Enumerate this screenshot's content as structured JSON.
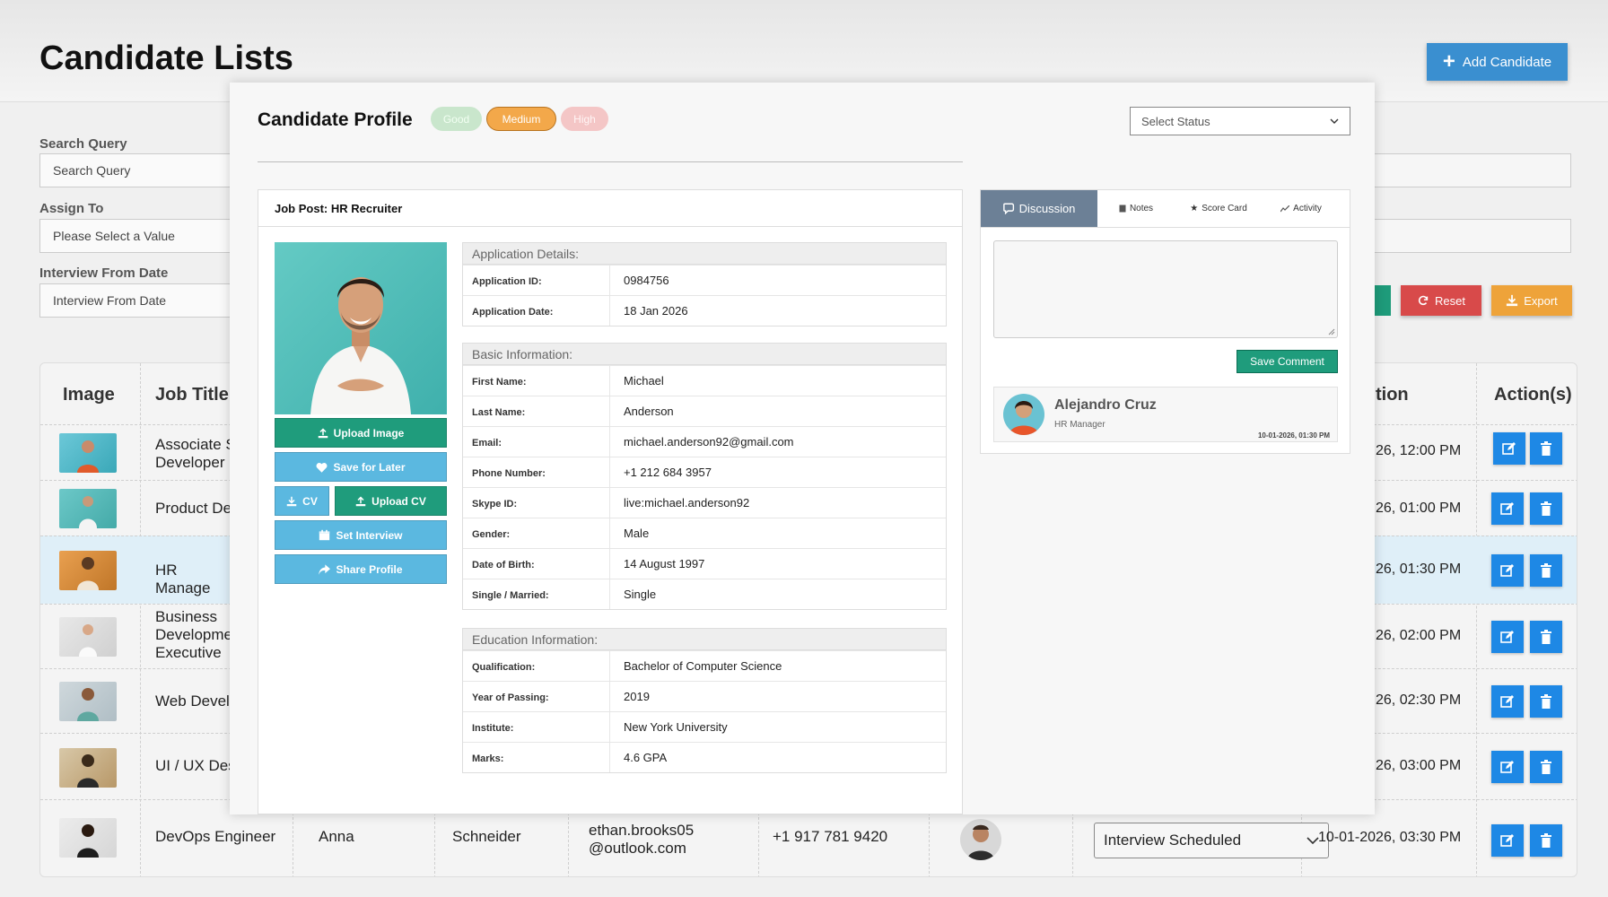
{
  "page": {
    "title": "Candidate Lists",
    "add_button": "Add Candidate",
    "reset_button": "Reset",
    "export_button": "Export"
  },
  "filters": {
    "search_label": "Search Query",
    "search_placeholder": "Search Query",
    "assign_label": "Assign To",
    "assign_value": "Please Select a Value",
    "interview_label": "Interview From Date",
    "interview_placeholder": "Interview From Date"
  },
  "table": {
    "headers": {
      "image": "Image",
      "job_title": "Job Title",
      "date_partial": "tion",
      "actions": "Action(s)"
    },
    "rows": [
      {
        "title": "Associate S Developer",
        "date": "26, 12:00 PM"
      },
      {
        "title": "Product De",
        "date": "26, 01:00 PM"
      },
      {
        "title": "HR Manage",
        "date": "26, 01:30 PM"
      },
      {
        "title": "Business Developme Executive",
        "date": "26, 02:00 PM"
      },
      {
        "title": "Web Devel",
        "date": "26, 02:30 PM"
      },
      {
        "title": "UI / UX Des",
        "date": "26, 03:00 PM"
      }
    ],
    "last_row": {
      "title": "DevOps Engineer",
      "first_name": "Anna",
      "last_name": "Schneider",
      "email_line1": "ethan.brooks05",
      "email_line2": "@outlook.com",
      "phone": "+1 917 781 9420",
      "status": "Interview Scheduled",
      "date": "10-01-2026, 03:30 PM"
    }
  },
  "modal": {
    "title": "Candidate Profile",
    "priority": {
      "good": "Good",
      "medium": "Medium",
      "high": "High"
    },
    "status_select": "Select Status",
    "job_post": "Job Post: HR Recruiter",
    "buttons": {
      "upload_image": "Upload Image",
      "save_later": "Save for Later",
      "cv": "CV",
      "upload_cv": "Upload CV",
      "set_interview": "Set Interview",
      "share_profile": "Share Profile"
    },
    "application": {
      "heading": "Application Details:",
      "id_label": "Application ID:",
      "id": "0984756",
      "date_label": "Application Date:",
      "date": "18 Jan 2026"
    },
    "basic": {
      "heading": "Basic Information:",
      "first_name_label": "First Name:",
      "first_name": "Michael",
      "last_name_label": "Last Name:",
      "last_name": "Anderson",
      "email_label": "Email:",
      "email": "michael.anderson92@gmail.com",
      "phone_label": "Phone Number:",
      "phone": "+1 212 684 3957",
      "skype_label": "Skype ID:",
      "skype": "live:michael.anderson92",
      "gender_label": "Gender:",
      "gender": "Male",
      "dob_label": "Date of Birth:",
      "dob": "14 August 1997",
      "marital_label": "Single / Married:",
      "marital": "Single"
    },
    "education": {
      "heading": "Education Information:",
      "qualification_label": "Qualification:",
      "qualification": "Bachelor of Computer Science",
      "year_label": "Year of Passing:",
      "year": "2019",
      "institute_label": "Institute:",
      "institute": "New York University",
      "marks_label": "Marks:",
      "marks": "4.6 GPA"
    },
    "tabs": {
      "discussion": "Discussion",
      "notes": "Notes",
      "scorecard": "Score Card",
      "activity": "Activity"
    },
    "save_comment": "Save Comment",
    "comment": {
      "name": "Alejandro Cruz",
      "role": "HR Manager",
      "time": "10-01-2026, 01:30 PM"
    }
  },
  "colors": {
    "primary_blue": "#1e88e5",
    "accent_green": "#1f9c7c",
    "light_blue": "#5bb8e0",
    "reset_red": "#d84a4a",
    "export_orange": "#eea33a",
    "medium_pill": "#f3a84a"
  }
}
